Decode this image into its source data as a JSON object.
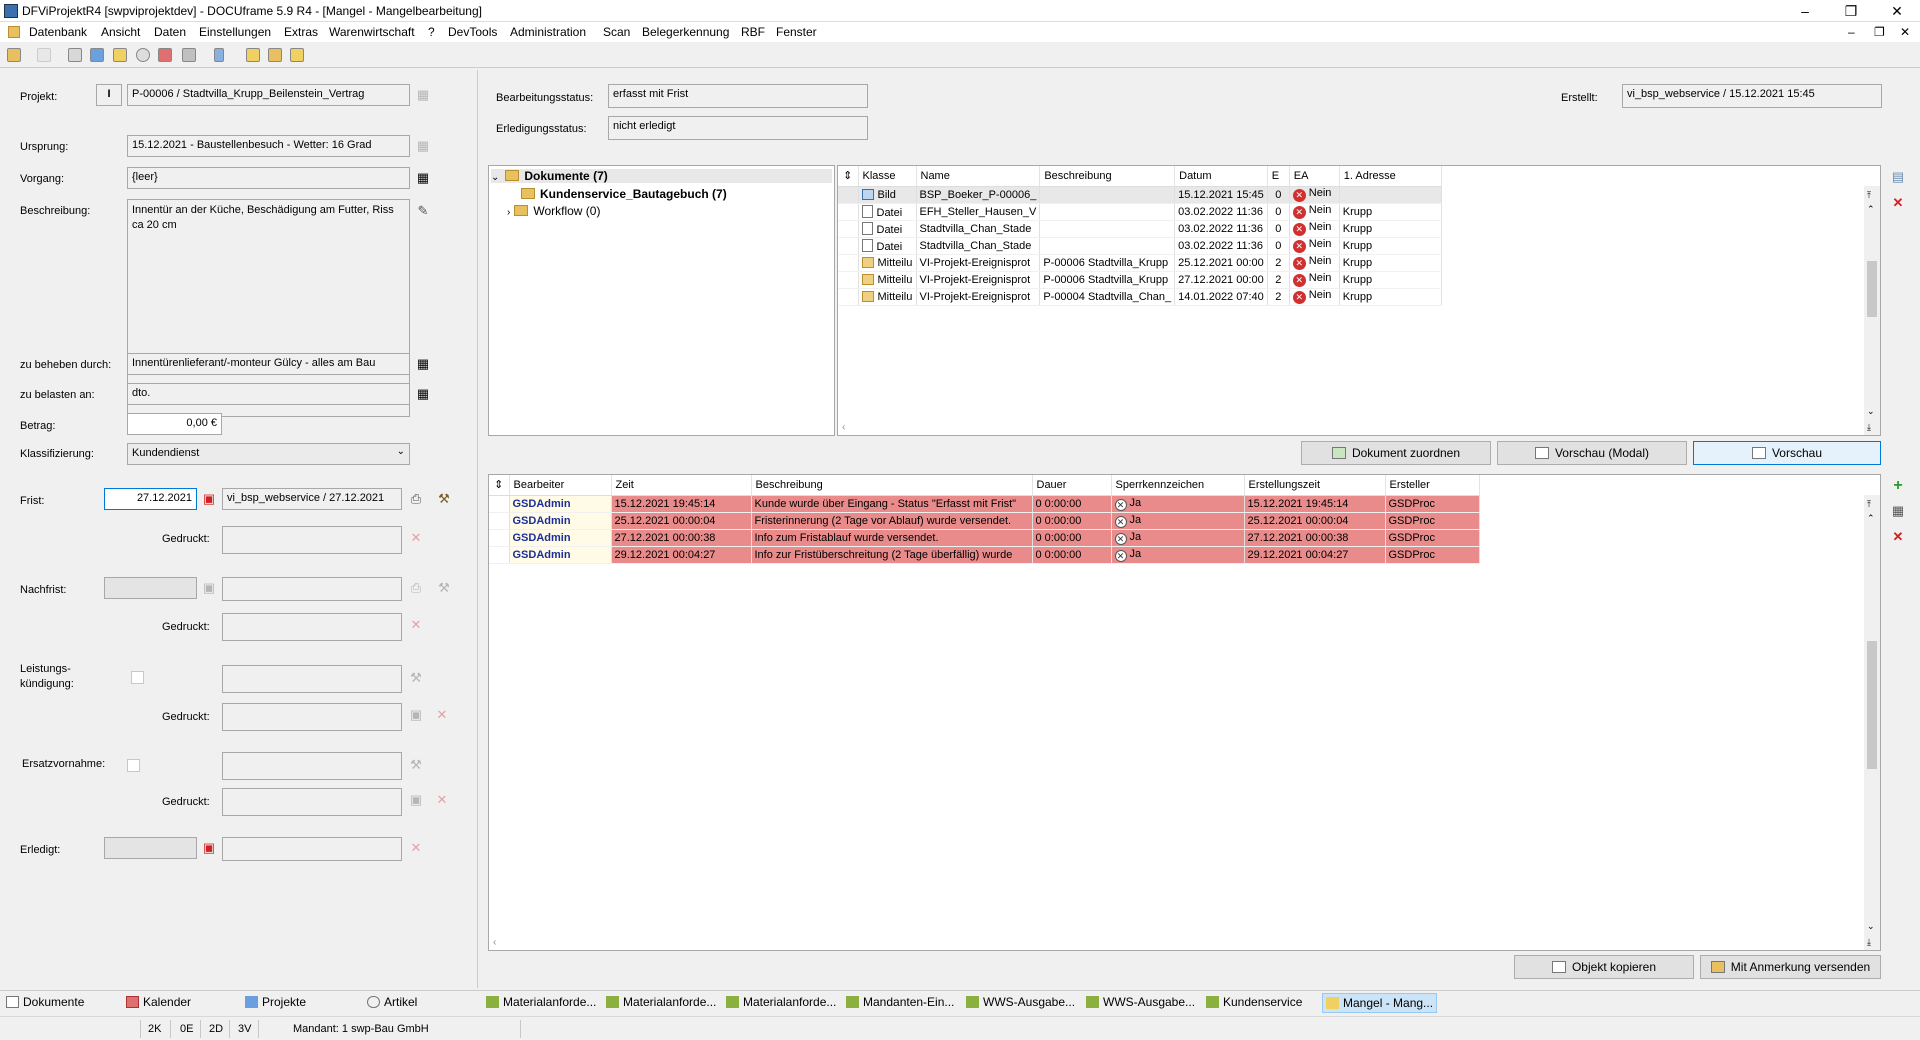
{
  "window": {
    "title": "DFViProjektR4 [swpviprojektdev] - DOCUframe 5.9 R4 - [Mangel - Mangelbearbeitung]"
  },
  "menu": [
    "Datenbank",
    "Ansicht",
    "Daten",
    "Einstellungen",
    "Extras",
    "Warenwirtschaft",
    "?",
    "DevTools",
    "Administration",
    "Scan",
    "Belegerkennung",
    "RBF",
    "Fenster"
  ],
  "form": {
    "projekt_label": "Projekt:",
    "projekt_prefix": "I",
    "projekt_value": "P-00006 / Stadtvilla_Krupp_Beilenstein_Vertrag",
    "ursprung_label": "Ursprung:",
    "ursprung_value": "15.12.2021 - Baustellenbesuch - Wetter: 16 Grad",
    "vorgang_label": "Vorgang:",
    "vorgang_value": "{leer}",
    "beschreibung_label": "Beschreibung:",
    "beschreibung_value": "Innentür an der Küche, Beschädigung am Futter, Riss ca 20 cm",
    "beheben_label": "zu beheben durch:",
    "beheben_value": "Innentürenlieferant/-monteur Gülcy - alles am Bau",
    "belasten_label": "zu belasten an:",
    "belasten_value": "dto.",
    "betrag_label": "Betrag:",
    "betrag_value": "0,00 €",
    "klassifizierung_label": "Klassifizierung:",
    "klassifizierung_value": "Kundendienst",
    "frist_label": "Frist:",
    "frist_date": "27.12.2021",
    "frist_user": "vi_bsp_webservice / 27.12.2021",
    "gedruckt_label": "Gedruckt:",
    "nachfrist_label": "Nachfrist:",
    "leistungskuendigung_label_1": "Leistungs-",
    "leistungskuendigung_label_2": "kündigung:",
    "ersatzvornahme_label": "Ersatzvornahme:",
    "erledigt_label": "Erledigt:"
  },
  "status": {
    "bearbeitung_label": "Bearbeitungsstatus:",
    "bearbeitung_value": "erfasst mit Frist",
    "erledigung_label": "Erledigungsstatus:",
    "erledigung_value": "nicht erledigt",
    "erstellt_label": "Erstellt:",
    "erstellt_value": "vi_bsp_webservice / 15.12.2021 15:45"
  },
  "tree": {
    "root": "Dokumente (7)",
    "child1": "Kundenservice_Bautagebuch (7)",
    "child2": "Workflow (0)"
  },
  "documents": {
    "columns": [
      "Klasse",
      "Name",
      "Beschreibung",
      "Datum",
      "E",
      "EA",
      "1. Adresse"
    ],
    "rows": [
      {
        "klasse": "Bild",
        "name": "BSP_Boeker_P-00006_",
        "beschreibung": "",
        "datum": "15.12.2021 15:45",
        "e": "0",
        "ea": "Nein",
        "adresse": "",
        "icon": "image-icon"
      },
      {
        "klasse": "Datei",
        "name": "EFH_Steller_Hausen_V",
        "beschreibung": "",
        "datum": "03.02.2022 11:36",
        "e": "0",
        "ea": "Nein",
        "adresse": "Krupp",
        "icon": "file-icon"
      },
      {
        "klasse": "Datei",
        "name": "Stadtvilla_Chan_Stade",
        "beschreibung": "",
        "datum": "03.02.2022 11:36",
        "e": "0",
        "ea": "Nein",
        "adresse": "Krupp",
        "icon": "file-icon"
      },
      {
        "klasse": "Datei",
        "name": "Stadtvilla_Chan_Stade",
        "beschreibung": "",
        "datum": "03.02.2022 11:36",
        "e": "0",
        "ea": "Nein",
        "adresse": "Krupp",
        "icon": "file-icon"
      },
      {
        "klasse": "Mitteilu",
        "name": "VI-Projekt-Ereignisprot",
        "beschreibung": "P-00006 Stadtvilla_Krupp",
        "datum": "25.12.2021 00:00",
        "e": "2",
        "ea": "Nein",
        "adresse": "Krupp",
        "icon": "message-icon"
      },
      {
        "klasse": "Mitteilu",
        "name": "VI-Projekt-Ereignisprot",
        "beschreibung": "P-00006 Stadtvilla_Krupp",
        "datum": "27.12.2021 00:00",
        "e": "2",
        "ea": "Nein",
        "adresse": "Krupp",
        "icon": "message-icon"
      },
      {
        "klasse": "Mitteilu",
        "name": "VI-Projekt-Ereignisprot",
        "beschreibung": "P-00004 Stadtvilla_Chan_",
        "datum": "14.01.2022 07:40",
        "e": "2",
        "ea": "Nein",
        "adresse": "Krupp",
        "icon": "message-icon"
      }
    ]
  },
  "doc_buttons": {
    "zuordnen": "Dokument zuordnen",
    "vorschau_modal": "Vorschau (Modal)",
    "vorschau": "Vorschau"
  },
  "log": {
    "columns": [
      "Bearbeiter",
      "Zeit",
      "Beschreibung",
      "Dauer",
      "Sperrkennzeichen",
      "Erstellungszeit",
      "Ersteller"
    ],
    "rows": [
      {
        "bearbeiter": "GSDAdmin",
        "zeit": "15.12.2021 19:45:14",
        "beschreibung": "Kunde wurde über Eingang - Status \"Erfasst mit Frist\"",
        "dauer": "0 0:00:00",
        "sperr": "Ja",
        "erstellungszeit": "15.12.2021 19:45:14",
        "ersteller": "GSDProc"
      },
      {
        "bearbeiter": "GSDAdmin",
        "zeit": "25.12.2021 00:00:04",
        "beschreibung": "Fristerinnerung (2 Tage vor Ablauf) wurde versendet.",
        "dauer": "0 0:00:00",
        "sperr": "Ja",
        "erstellungszeit": "25.12.2021 00:00:04",
        "ersteller": "GSDProc"
      },
      {
        "bearbeiter": "GSDAdmin",
        "zeit": "27.12.2021 00:00:38",
        "beschreibung": "Info zum Fristablauf wurde versendet.",
        "dauer": "0 0:00:00",
        "sperr": "Ja",
        "erstellungszeit": "27.12.2021 00:00:38",
        "ersteller": "GSDProc"
      },
      {
        "bearbeiter": "GSDAdmin",
        "zeit": "29.12.2021 00:04:27",
        "beschreibung": "Info zur Fristüberschreitung (2 Tage überfällig) wurde",
        "dauer": "0 0:00:00",
        "sperr": "Ja",
        "erstellungszeit": "29.12.2021 00:04:27",
        "ersteller": "GSDProc"
      }
    ]
  },
  "bottom_buttons": {
    "kopieren": "Objekt kopieren",
    "versenden": "Mit Anmerkung versenden"
  },
  "taskbar": [
    "Dokumente",
    "Kalender",
    "Projekte",
    "Artikel",
    "Materialanforde...",
    "Materialanforde...",
    "Materialanforde...",
    "Mandanten-Ein...",
    "WWS-Ausgabe...",
    "WWS-Ausgabe...",
    "Kundenservice",
    "Mangel - Mang..."
  ],
  "statusbar": {
    "s1": "2K",
    "s2": "0E",
    "s3": "2D",
    "s4": "3V",
    "mandant": "Mandant: 1 swp-Bau GmbH"
  },
  "colors": {
    "row_red": "#ea8b8b",
    "bearbeiter_blue": "#1a2f9a",
    "accent": "#0078d7"
  }
}
